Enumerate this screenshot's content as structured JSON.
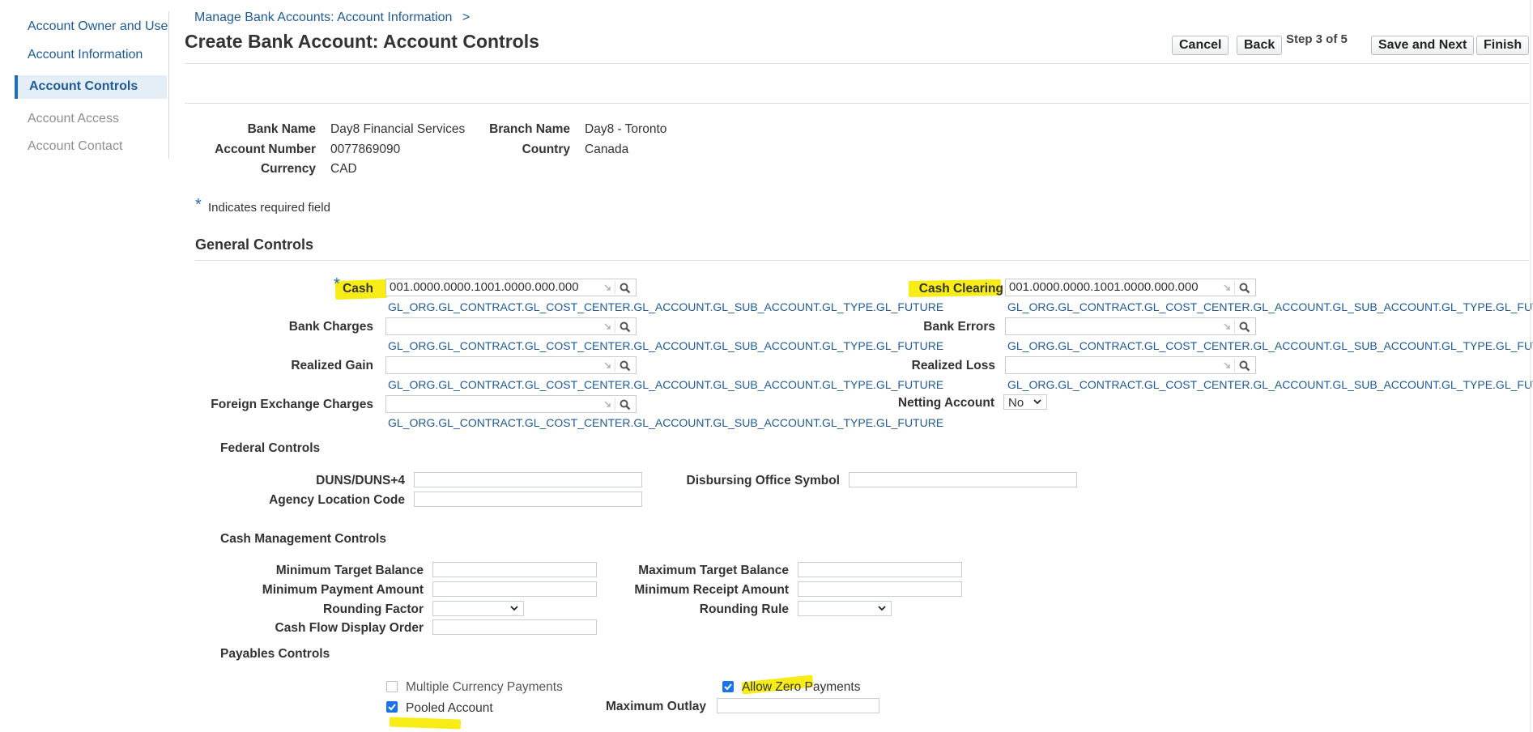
{
  "nav": {
    "items": [
      {
        "label": "Account Owner and Use"
      },
      {
        "label": "Account Information"
      },
      {
        "label": "Account Controls"
      },
      {
        "label": "Account Access"
      },
      {
        "label": "Account Contact"
      }
    ]
  },
  "header": {
    "breadcrumb": "Manage Bank Accounts: Account Information",
    "breadcrumb_sep": ">",
    "title": "Create Bank Account: Account Controls",
    "buttons": {
      "cancel": "Cancel",
      "back": "Back",
      "save_next": "Save and Next",
      "finish": "Finish"
    },
    "step": "Step 3 of 5"
  },
  "bank_info": {
    "bank_name_label": "Bank Name",
    "bank_name": "Day8 Financial Services",
    "branch_name_label": "Branch Name",
    "branch_name": "Day8 - Toronto",
    "account_number_label": "Account Number",
    "account_number": "0077869090",
    "country_label": "Country",
    "country": "Canada",
    "currency_label": "Currency",
    "currency": "CAD"
  },
  "required_note": {
    "star": "*",
    "text": "Indicates required field"
  },
  "general": {
    "title": "General Controls",
    "hint": "GL_ORG.GL_CONTRACT.GL_COST_CENTER.GL_ACCOUNT.GL_SUB_ACCOUNT.GL_TYPE.GL_FUTURE",
    "cash_label": "Cash",
    "cash_value": "001.0000.0000.1001.0000.000.000",
    "cash_clearing_label": "Cash Clearing",
    "cash_clearing_value": "001.0000.0000.1001.0000.000.000",
    "bank_charges_label": "Bank Charges",
    "bank_charges_value": "",
    "bank_errors_label": "Bank Errors",
    "bank_errors_value": "",
    "realized_gain_label": "Realized Gain",
    "realized_gain_value": "",
    "realized_loss_label": "Realized Loss",
    "realized_loss_value": "",
    "fx_charges_label": "Foreign Exchange Charges",
    "fx_charges_value": "",
    "netting_label": "Netting Account",
    "netting_value": "No"
  },
  "federal": {
    "title": "Federal Controls",
    "duns_label": "DUNS/DUNS+4",
    "duns_value": "",
    "disbursing_label": "Disbursing Office Symbol",
    "disbursing_value": "",
    "agency_label": "Agency Location Code",
    "agency_value": ""
  },
  "cash_mgmt": {
    "title": "Cash Management Controls",
    "min_target_label": "Minimum Target Balance",
    "min_target_value": "",
    "max_target_label": "Maximum Target Balance",
    "max_target_value": "",
    "min_payment_label": "Minimum Payment Amount",
    "min_payment_value": "",
    "min_receipt_label": "Minimum Receipt Amount",
    "min_receipt_value": "",
    "rounding_factor_label": "Rounding Factor",
    "rounding_factor_value": "",
    "rounding_rule_label": "Rounding Rule",
    "rounding_rule_value": "",
    "cash_flow_label": "Cash Flow Display Order",
    "cash_flow_value": ""
  },
  "payables": {
    "title": "Payables Controls",
    "multi_currency_label": "Multiple Currency Payments",
    "multi_currency_checked": false,
    "allow_zero_label": "Allow Zero Payments",
    "allow_zero_checked": true,
    "pooled_label": "Pooled Account",
    "pooled_checked": true,
    "max_outlay_label": "Maximum Outlay",
    "max_outlay_value": ""
  },
  "colors": {
    "link": "#1f5a96",
    "highlight": "#f7ec15",
    "accent": "#1f6fb2",
    "checkbox": "#1a73e8"
  }
}
